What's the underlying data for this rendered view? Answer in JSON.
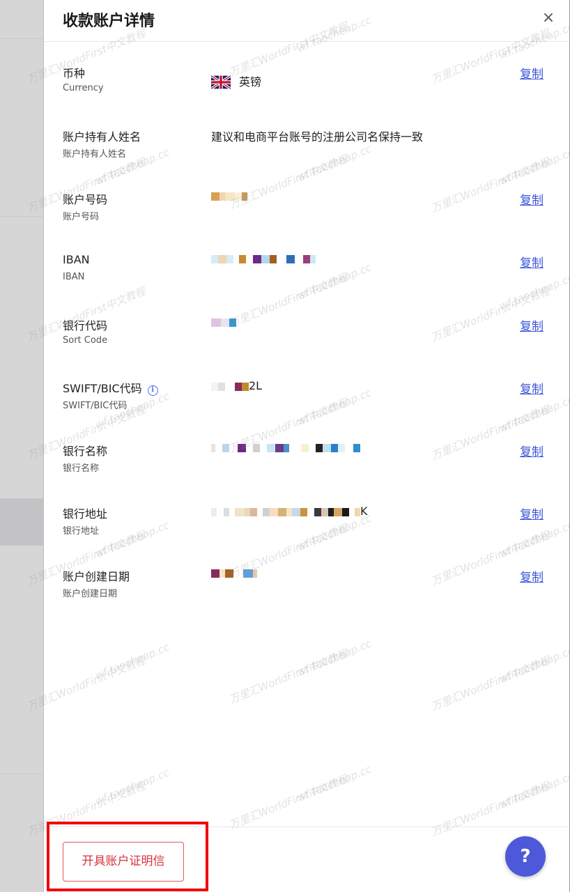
{
  "dialog": {
    "title": "收款账户详情",
    "close_glyph": "×"
  },
  "rows": [
    {
      "label": "币种",
      "sublabel": "Currency",
      "value": "英镑",
      "copy": "复制"
    },
    {
      "label": "账户持有人姓名",
      "sublabel": "账户持有人姓名",
      "value": "建议和电商平台账号的注册公司名保持一致"
    },
    {
      "label": "账户号码",
      "sublabel": "账户号码",
      "value": "",
      "copy": "复制"
    },
    {
      "label": "IBAN",
      "sublabel": "IBAN",
      "value": "",
      "copy": "复制"
    },
    {
      "label": "银行代码",
      "sublabel": "Sort Code",
      "value": "",
      "copy": "复制"
    },
    {
      "label": "SWIFT/BIC代码",
      "sublabel": "SWIFT/BIC代码",
      "value": "2L",
      "copy": "复制"
    },
    {
      "label": "银行名称",
      "sublabel": "银行名称",
      "value": "",
      "copy": "复制"
    },
    {
      "label": "银行地址",
      "sublabel": "银行地址",
      "value": "K",
      "copy": "复制"
    },
    {
      "label": "账户创建日期",
      "sublabel": "账户创建日期",
      "value": "",
      "copy": "复制"
    }
  ],
  "footer": {
    "account_letter_button": "开具账户证明信",
    "help_glyph": "?"
  },
  "watermark": {
    "line1": "万里汇WorldFirst中文教程",
    "line2": "wf.taocheap.cc"
  },
  "colors": {
    "accent": "#3b55d9",
    "danger": "#d6333b",
    "highlight_box": "#f0000a",
    "help_button": "#4d59d9"
  },
  "icons": {
    "currency_flag": "uk-flag-icon",
    "close": "close-icon",
    "info": "info-icon",
    "help": "help-icon"
  }
}
